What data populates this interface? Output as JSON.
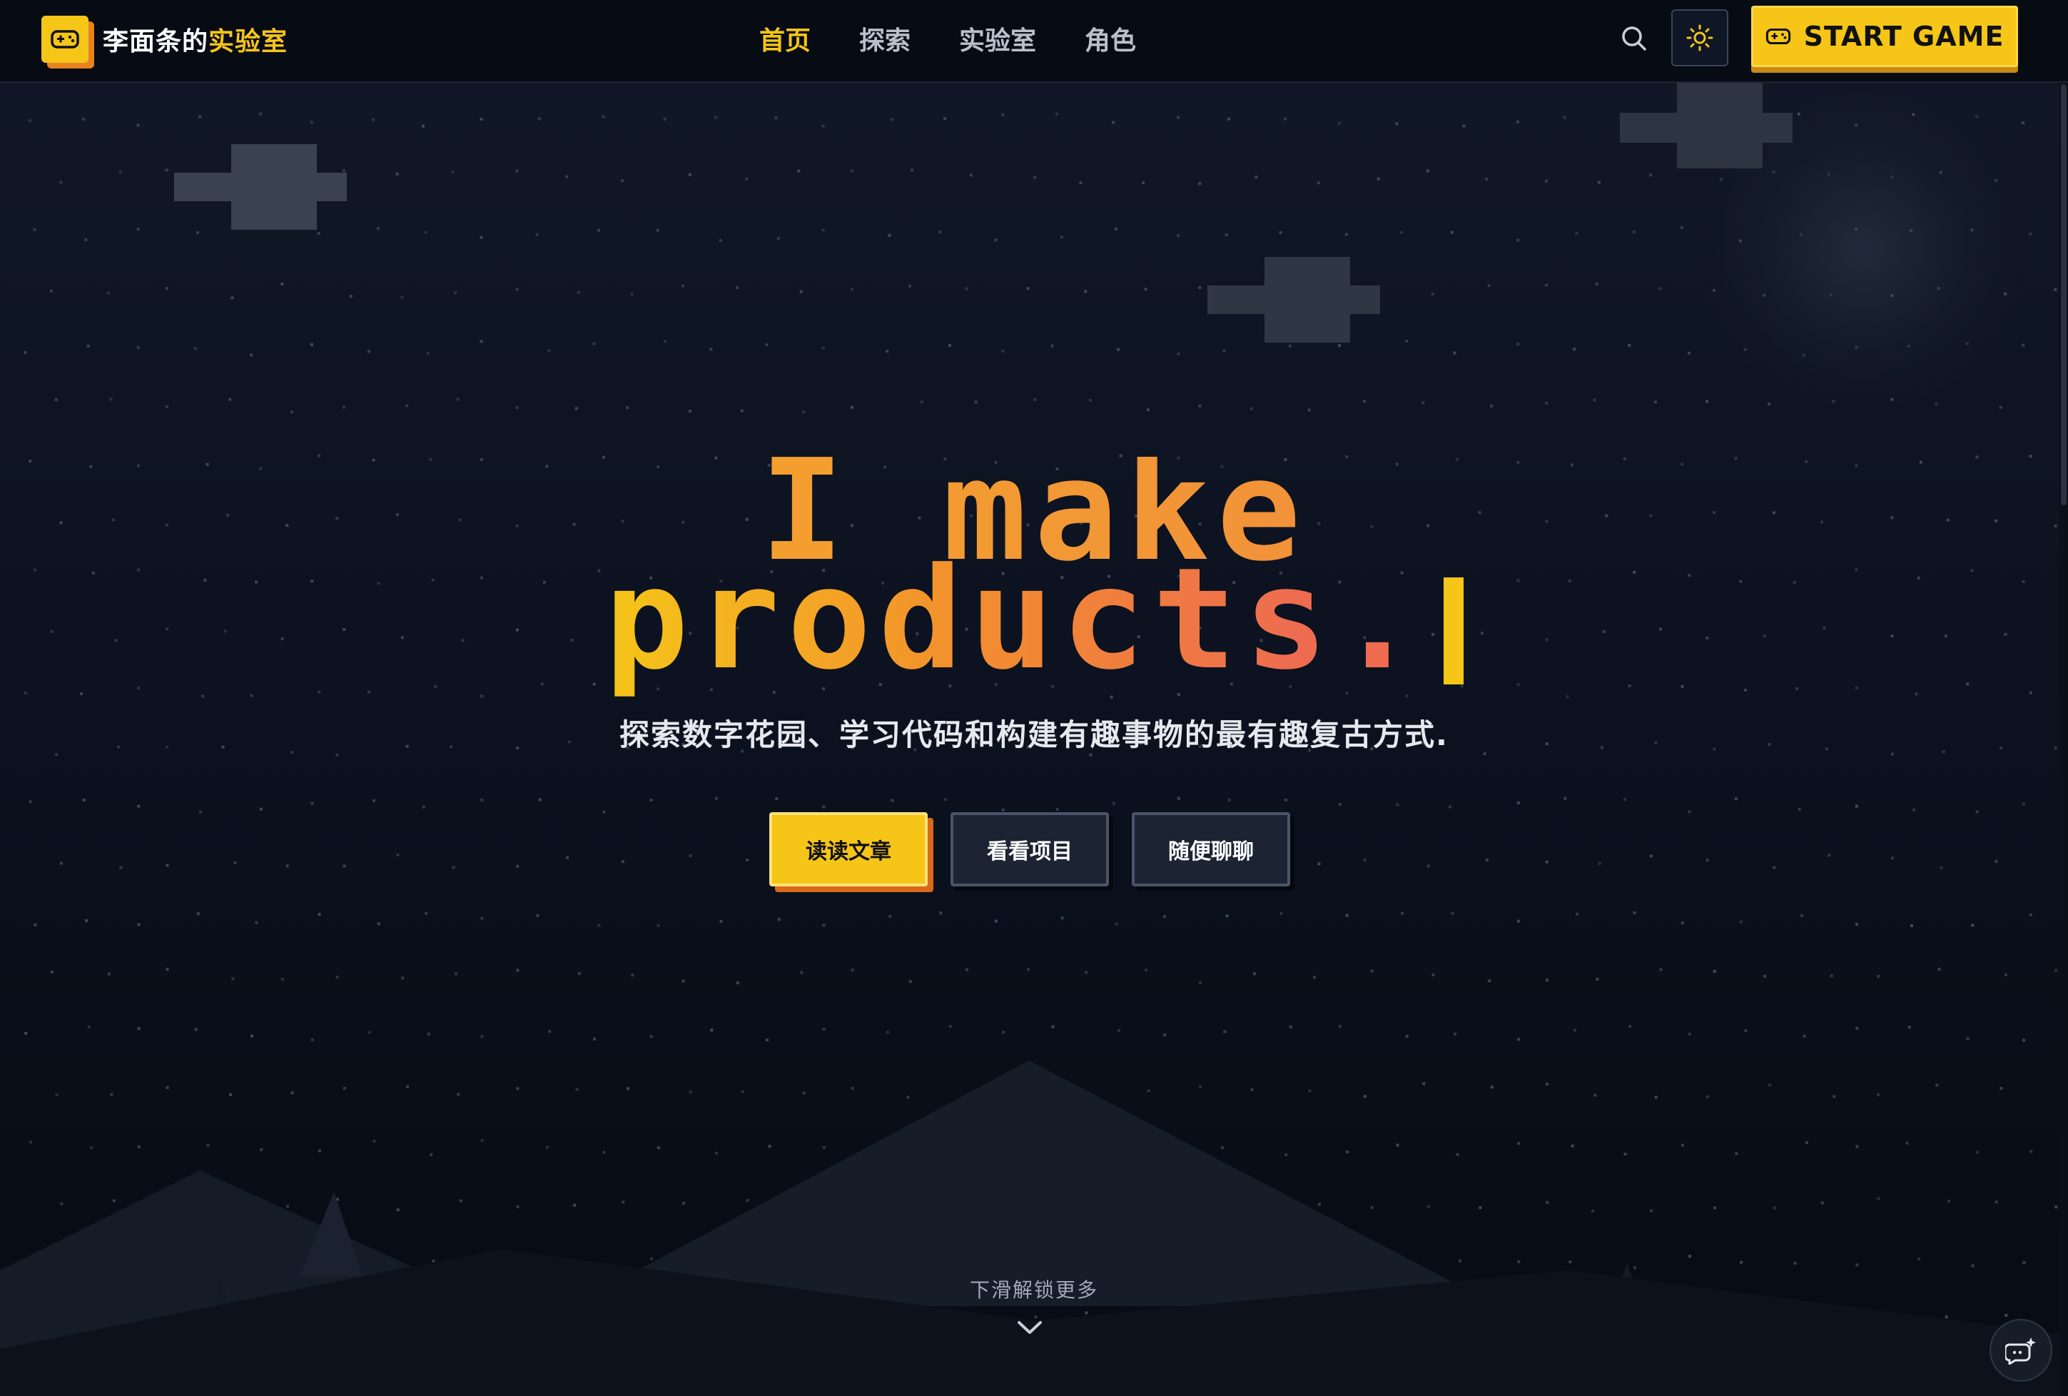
{
  "header": {
    "brand_name": "李面条的",
    "brand_accent": "实验室",
    "logo_icon": "gamepad-icon",
    "nav": [
      {
        "label": "首页",
        "active": true
      },
      {
        "label": "探索",
        "active": false
      },
      {
        "label": "实验室",
        "active": false
      },
      {
        "label": "角色",
        "active": false
      }
    ],
    "search_icon": "search-icon",
    "theme_icon": "sun-icon",
    "start_button": "START GAME"
  },
  "hero": {
    "title_line1": "I make",
    "title_line2": "products.",
    "subtitle": "探索数字花园、学习代码和构建有趣事物的最有趣复古方式.",
    "buttons": [
      "读读文章",
      "看看项目",
      "随便聊聊"
    ]
  },
  "footer": {
    "scroll_hint": "下滑解锁更多",
    "scroll_icon": "chevron-down-icon",
    "chat_icon": "chat-bot-icon"
  },
  "colors": {
    "accent": "#f5c518",
    "accent_shadow": "#d96a1a",
    "background": "#0c1220",
    "title_gradient_end": "#ee6b50"
  }
}
